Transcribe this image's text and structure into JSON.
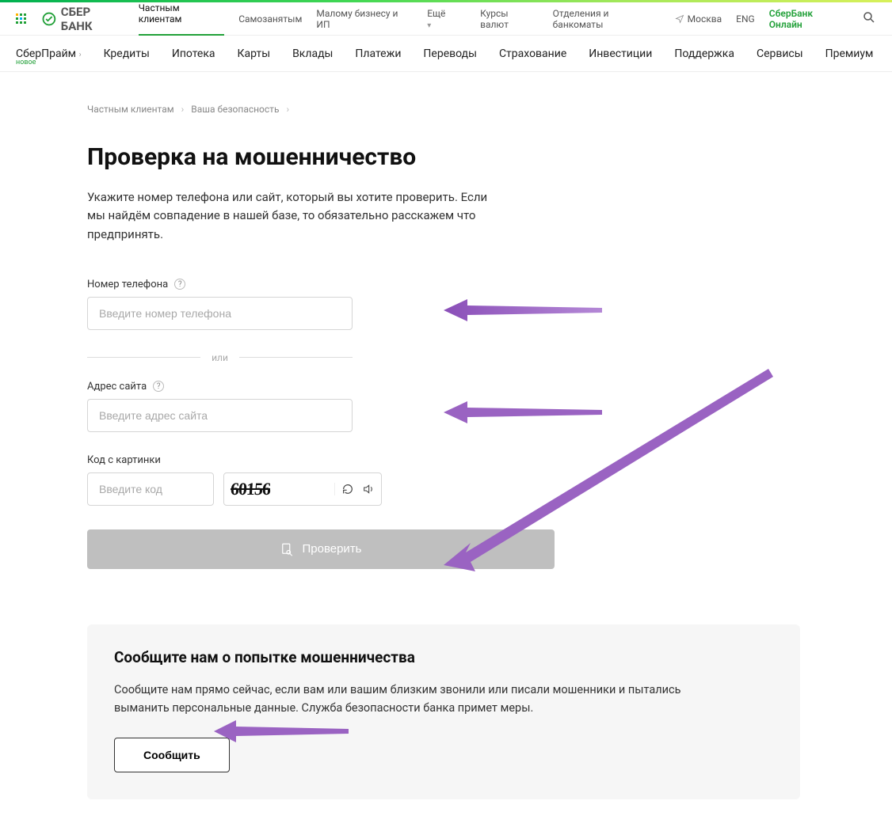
{
  "brand": "СБЕР БАНК",
  "topnav": {
    "items": [
      "Частным клиентам",
      "Самозанятым",
      "Малому бизнесу и ИП",
      "Ещё"
    ],
    "right": {
      "rates": "Курсы валют",
      "branches": "Отделения и банкоматы",
      "city": "Москва",
      "lang": "ENG",
      "online": "СберБанк Онлайн"
    }
  },
  "mainnav": {
    "items": [
      "СберПрайм",
      "Кредиты",
      "Ипотека",
      "Карты",
      "Вклады",
      "Платежи",
      "Переводы",
      "Страхование",
      "Инвестиции",
      "Поддержка",
      "Сервисы",
      "Премиум"
    ],
    "badge_new": "новое"
  },
  "breadcrumb": {
    "a": "Частным клиентам",
    "b": "Ваша безопасность"
  },
  "page": {
    "title": "Проверка на мошенничество",
    "lead": "Укажите номер телефона или сайт, который вы хотите проверить. Если мы найдём совпадение в нашей базе, то обязательно расскажем что предпринять."
  },
  "form": {
    "phone_label": "Номер телефона",
    "phone_placeholder": "Введите номер телефона",
    "or": "или",
    "site_label": "Адрес сайта",
    "site_placeholder": "Введите адрес сайта",
    "captcha_label": "Код с картинки",
    "captcha_placeholder": "Введите код",
    "captcha_value": "60156",
    "submit": "Проверить"
  },
  "report": {
    "title": "Сообщите нам о попытке мошенничества",
    "text": "Сообщите нам прямо сейчас, если вам или вашим близким звонили или писали мошенники и пытались выманить персональные данные. Служба безопасности банка примет меры.",
    "button": "Сообщить"
  }
}
